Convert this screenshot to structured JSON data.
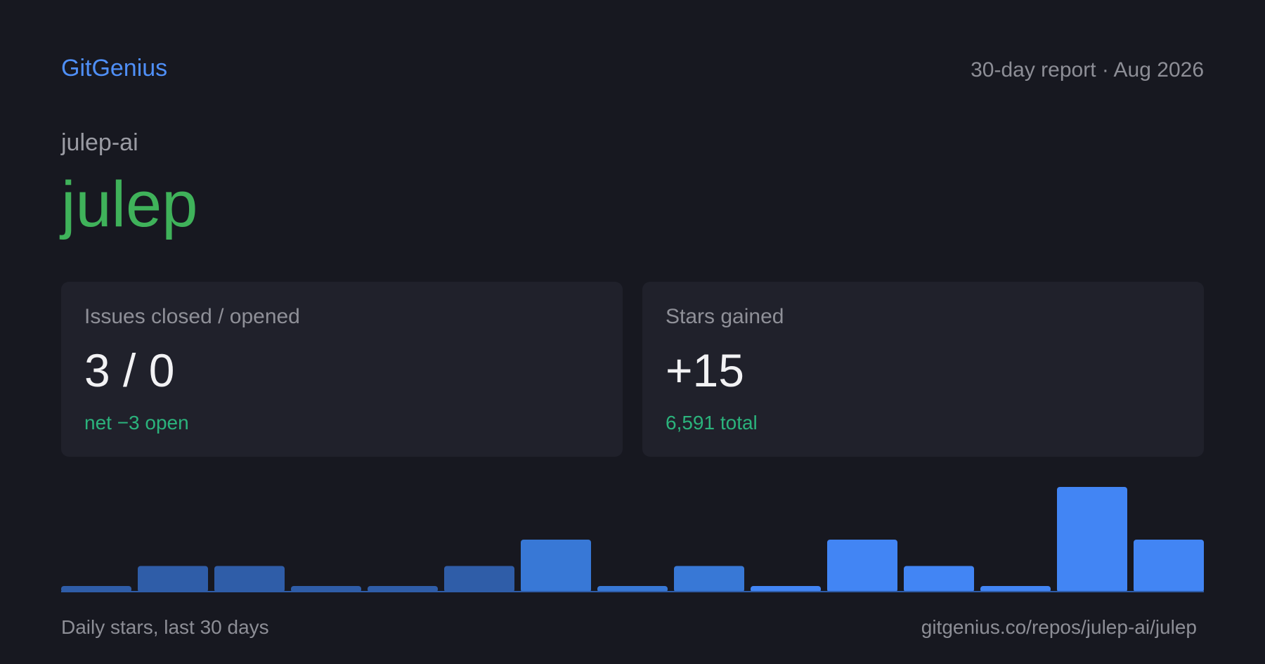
{
  "header": {
    "brand": "GitGenius",
    "report_label": "30-day report · Aug 2026"
  },
  "repo": {
    "owner": "julep-ai",
    "name": "julep"
  },
  "cards": {
    "issues": {
      "label": "Issues closed / opened",
      "value": "3 / 0",
      "sub": "net −3 open"
    },
    "stars": {
      "label": "Stars gained",
      "value": "+15",
      "sub": "6,591 total"
    }
  },
  "footer": {
    "caption": "Daily stars, last 30 days",
    "url": "gitgenius.co/repos/julep-ai/julep"
  },
  "colors": {
    "background": "#171820",
    "brand": "#4f8ff7",
    "repo_name": "#3fb25a",
    "card_bg": "#20212b",
    "positive": "#2bb37c",
    "bar_dark": "#2f5da8",
    "bar_mid": "#3878d6",
    "bar_bright": "#4285f4"
  },
  "chart_data": {
    "type": "bar",
    "values": [
      0,
      1,
      1,
      0,
      0,
      1,
      2,
      0,
      1,
      0,
      2,
      1,
      0,
      4,
      2
    ],
    "ylim": [
      0,
      4
    ],
    "grid": false,
    "legend": "none"
  }
}
